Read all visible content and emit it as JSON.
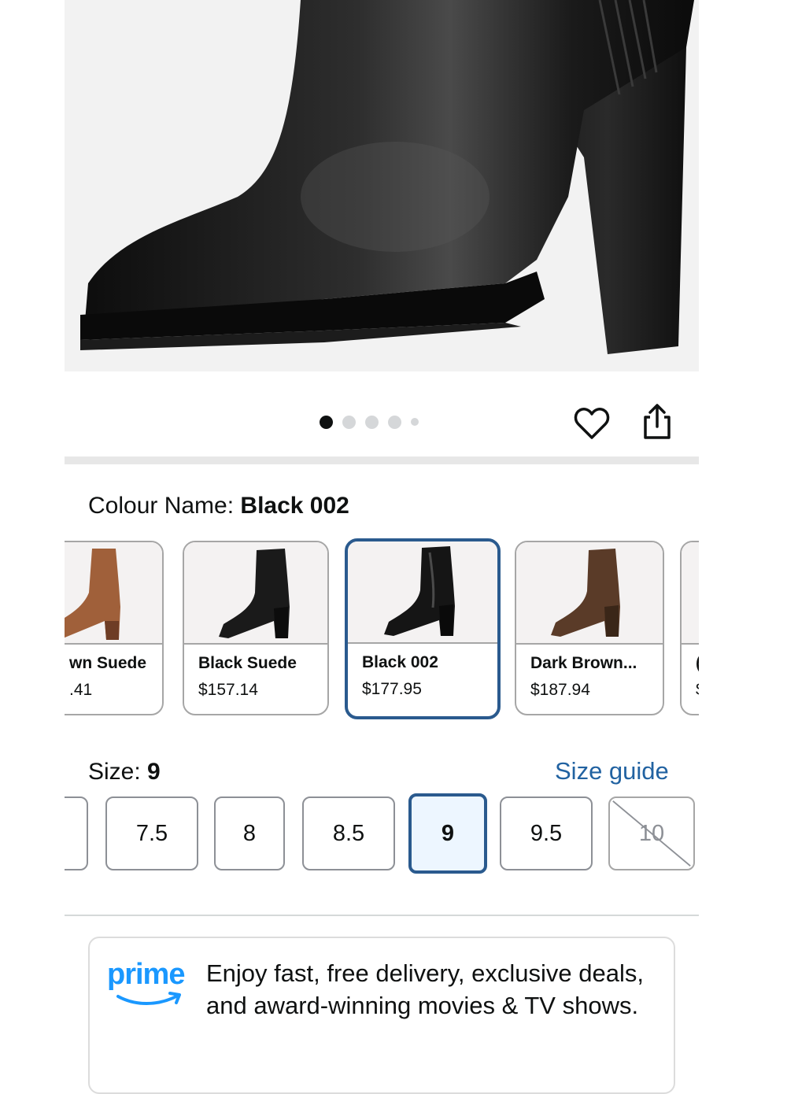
{
  "gallery": {
    "image_count": 5,
    "active_index": 0
  },
  "icons": {
    "wishlist": "heart-outline-icon",
    "share": "share-upload-icon"
  },
  "colour": {
    "label": "Colour Name:",
    "selected": "Black 002"
  },
  "swatches": [
    {
      "name": "wn Suede",
      "price": ".41",
      "color": "#a0603a",
      "state": "partial-left"
    },
    {
      "name": "Black Suede",
      "price": "$157.14",
      "color": "#1a1a1a",
      "state": "normal"
    },
    {
      "name": "Black 002",
      "price": "$177.95",
      "color": "#151515",
      "state": "selected"
    },
    {
      "name": "Dark Brown...",
      "price": "$187.94",
      "color": "#5a3b28",
      "state": "normal"
    },
    {
      "name": "(",
      "price": "$",
      "color": "#888888",
      "state": "partial-right"
    }
  ],
  "size": {
    "label": "Size:",
    "selected": "9",
    "guide_label": "Size guide"
  },
  "sizes": [
    {
      "label": "",
      "state": "partial-left"
    },
    {
      "label": "7.5",
      "state": "available"
    },
    {
      "label": "8",
      "state": "available"
    },
    {
      "label": "8.5",
      "state": "available"
    },
    {
      "label": "9",
      "state": "selected"
    },
    {
      "label": "9.5",
      "state": "available"
    },
    {
      "label": "10",
      "state": "unavailable"
    }
  ],
  "prime": {
    "logo_text": "prime",
    "brand_color": "#1a98ff",
    "text": "Enjoy fast, free delivery, exclusive deals, and award-winning movies & TV shows."
  },
  "colors": {
    "selected_border": "#2a5a8e",
    "link": "#2162a1"
  }
}
